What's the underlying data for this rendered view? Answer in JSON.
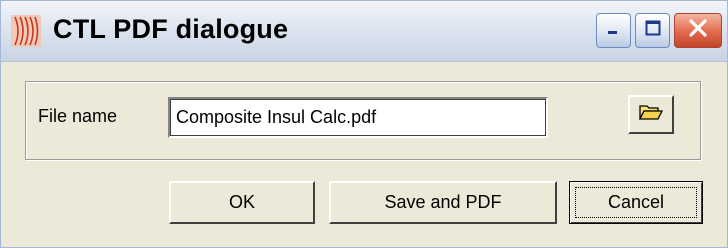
{
  "window": {
    "title": "CTL PDF dialogue",
    "app_icon": "ctl-app-icon",
    "controls": [
      "minimize-icon",
      "maximize-icon",
      "close-icon"
    ]
  },
  "form": {
    "file_name_label": "File name",
    "file_name_value": "Composite Insul Calc.pdf",
    "browse_icon": "folder-open-icon"
  },
  "buttons": {
    "ok_label": "OK",
    "save_label": "Save and PDF",
    "cancel_label": "Cancel"
  }
}
